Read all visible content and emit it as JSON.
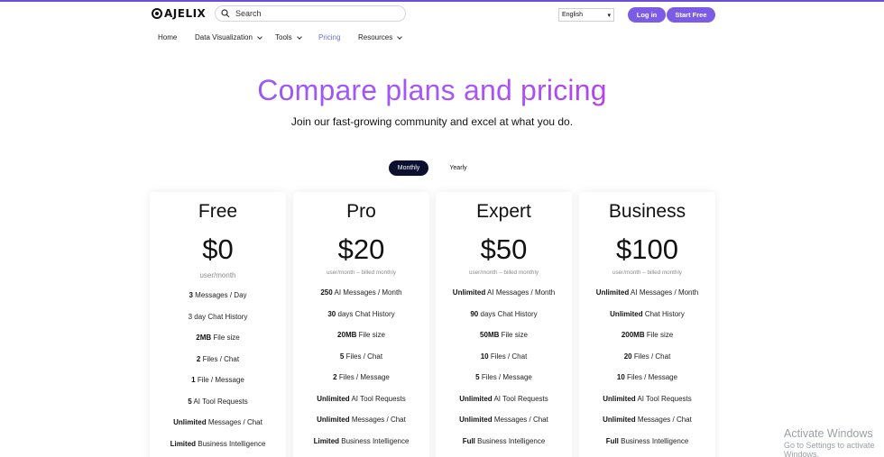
{
  "header": {
    "logo_text": "AJELIX",
    "search_placeholder": "Search",
    "language": "English",
    "login_label": "Log in",
    "start_label": "Start Free"
  },
  "nav": {
    "items": [
      {
        "label": "Home"
      },
      {
        "label": "Data Visualization"
      },
      {
        "label": "Tools"
      },
      {
        "label": "Pricing"
      },
      {
        "label": "Resources"
      }
    ]
  },
  "hero": {
    "title": "Compare plans and pricing",
    "subtitle": "Join our fast-growing community and excel at what you do."
  },
  "billing_toggle": {
    "monthly": "Monthly",
    "yearly": "Yearly"
  },
  "plans": [
    {
      "name": "Free",
      "price": "$0",
      "period": "user/month",
      "features": [
        {
          "bold": "3",
          "text": " Messages / Day"
        },
        {
          "bold": "",
          "text": "3 day Chat History"
        },
        {
          "bold": "2MB",
          "text": " File size"
        },
        {
          "bold": "2",
          "text": " Files / Chat"
        },
        {
          "bold": "1",
          "text": " File / Message"
        },
        {
          "bold": "5",
          "text": " AI Tool Requests"
        },
        {
          "bold": "Unlimited",
          "text": " Messages / Chat"
        },
        {
          "bold": "Limited",
          "text": " Business Intelligence"
        }
      ]
    },
    {
      "name": "Pro",
      "price": "$20",
      "period": "user/month – billed monthly",
      "features": [
        {
          "bold": "250",
          "text": " AI Messages / Month"
        },
        {
          "bold": "30",
          "text": " days Chat History"
        },
        {
          "bold": "20MB",
          "text": " File size"
        },
        {
          "bold": "5",
          "text": " Files / Chat"
        },
        {
          "bold": "2",
          "text": " Files / Message"
        },
        {
          "bold": "Unlimited",
          "text": " AI Tool Requests"
        },
        {
          "bold": "Unlimited",
          "text": " Messages / Chat"
        },
        {
          "bold": "Limited",
          "text": " Business Intelligence"
        }
      ]
    },
    {
      "name": "Expert",
      "price": "$50",
      "period": "user/month – billed monthly",
      "features": [
        {
          "bold": "Unlimited",
          "text": " AI Messages / Month"
        },
        {
          "bold": "90",
          "text": " days Chat History"
        },
        {
          "bold": "50MB",
          "text": " File size"
        },
        {
          "bold": "10",
          "text": " Files / Chat"
        },
        {
          "bold": "5",
          "text": " Files / Message"
        },
        {
          "bold": "Unlimited",
          "text": " AI Tool Requests"
        },
        {
          "bold": "Unlimited",
          "text": " Messages / Chat"
        },
        {
          "bold": "Full",
          "text": " Business Intelligence"
        }
      ]
    },
    {
      "name": "Business",
      "price": "$100",
      "period": "user/month – billed monthly",
      "features": [
        {
          "bold": "Unlimited",
          "text": " AI Messages / Month"
        },
        {
          "bold": "Unlimited",
          "text": " Chat History"
        },
        {
          "bold": "200MB",
          "text": " File size"
        },
        {
          "bold": "20",
          "text": " Files / Chat"
        },
        {
          "bold": "10",
          "text": " Files / Message"
        },
        {
          "bold": "Unlimited",
          "text": " AI Tool Requests"
        },
        {
          "bold": "Unlimited",
          "text": " Messages / Chat"
        },
        {
          "bold": "Full",
          "text": " Business Intelligence"
        }
      ]
    }
  ],
  "watermark": {
    "title": "Activate Windows",
    "subtitle": "Go to Settings to activate Windows."
  }
}
